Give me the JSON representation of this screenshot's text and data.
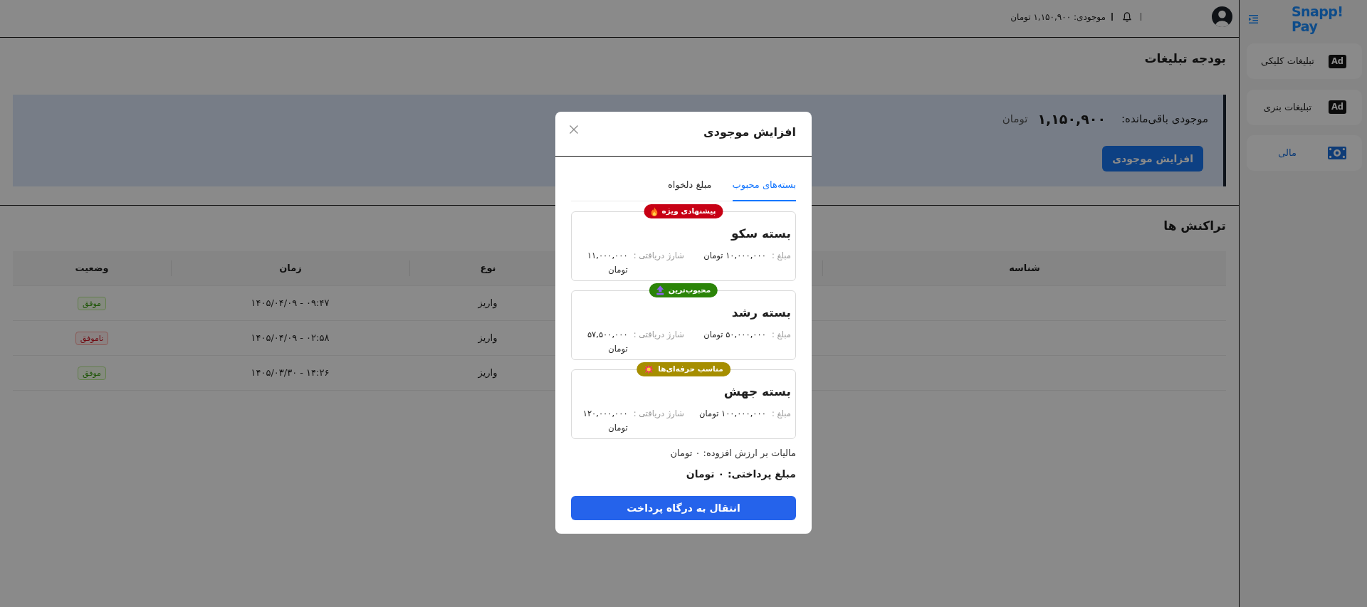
{
  "sidebar": {
    "logo": "Snapp! Pay",
    "items": [
      {
        "label": "تبلیغات کلیکی",
        "kind": "ad",
        "icon_label": "Ad",
        "selected": false
      },
      {
        "label": "تبلیغات بنری",
        "kind": "ad",
        "icon_label": "Ad",
        "selected": false
      },
      {
        "label": "مالی",
        "kind": "money",
        "selected": true
      }
    ]
  },
  "header": {
    "balance": "موجودی: ۱,۱۵۰,۹۰۰ تومان"
  },
  "budget": {
    "title": "بودجه تبلیغات",
    "balance_label": "موجودی باقی‌مانده:",
    "balance_amount": "۱,۱۵۰,۹۰۰",
    "balance_unit": "تومان",
    "button": "افزایش موجودی"
  },
  "transactions": {
    "title": "تراکنش ها",
    "table": {
      "columns": [
        "شناسه",
        "نوع",
        "زمان",
        "وضعیت"
      ],
      "rows": [
        {
          "type": "واریز",
          "time": "۱۴۰۵/۰۴/۰۹ - ۰۹:۴۷",
          "status": {
            "text": "موفق",
            "kind": "success"
          }
        },
        {
          "type": "واریز",
          "time": "۱۴۰۵/۰۴/۰۹ - ۰۲:۵۸",
          "status": {
            "text": "ناموفق",
            "kind": "failure"
          }
        },
        {
          "type": "واریز",
          "time": "۱۴۰۵/۰۳/۳۰ - ۱۴:۲۶",
          "status": {
            "text": "موفق",
            "kind": "success"
          }
        }
      ]
    }
  },
  "modal": {
    "title": "افزایش موجودی",
    "tabs": [
      {
        "label": "بسته‌های محبوب",
        "selected": true
      },
      {
        "label": "مبلغ دلخواه",
        "selected": false
      }
    ],
    "packages": [
      {
        "badge": {
          "text": "پیشنهادی ویژه",
          "color": "#c70014",
          "kind": "special"
        },
        "name": "بسته سکو",
        "price_label": "مبلغ :",
        "price": "۱۰,۰۰۰,۰۰۰ تومان",
        "charge_label": "شارژ دریافتی :",
        "charge": "۱۱,۰۰۰,۰۰۰ تومان",
        "selected": false
      },
      {
        "badge": {
          "text": "محبوب‌ترین",
          "color": "#2b8408",
          "kind": "popular"
        },
        "name": "بسته رشد",
        "price_label": "مبلغ :",
        "price": "۵۰,۰۰۰,۰۰۰ تومان",
        "charge_label": "شارژ دریافتی :",
        "charge": "۵۷,۵۰۰,۰۰۰ تومان",
        "selected": false
      },
      {
        "badge": {
          "text": "مناسب حرفه‌ای‌ها",
          "color": "#a68e00",
          "kind": "pro"
        },
        "name": "بسته جهش",
        "price_label": "مبلغ :",
        "price": "۱۰۰,۰۰۰,۰۰۰ تومان",
        "charge_label": "شارژ دریافتی :",
        "charge": "۱۲۰,۰۰۰,۰۰۰ تومان",
        "selected": false
      }
    ],
    "vat": "مالیات بر ارزش افزوده: ۰ تومان",
    "payable": "مبلغ پرداختی: ۰ تومان",
    "button": "انتقال به درگاه پرداخت"
  }
}
